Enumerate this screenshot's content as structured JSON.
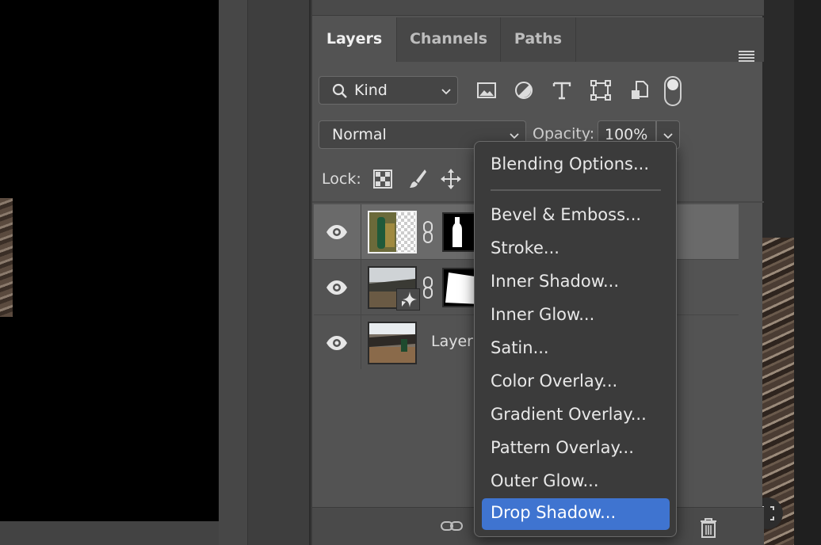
{
  "panel": {
    "tabs": [
      {
        "label": "Layers",
        "active": true
      },
      {
        "label": "Channels",
        "active": false
      },
      {
        "label": "Paths",
        "active": false
      }
    ],
    "filter": {
      "kind_label": "Kind",
      "icons": [
        "image-filter-icon",
        "adjustment-filter-icon",
        "type-filter-icon",
        "shape-filter-icon",
        "smart-object-filter-icon"
      ]
    },
    "blend_mode": "Normal",
    "opacity_label": "Opacity:",
    "opacity_value": "100%",
    "lock_label": "Lock:",
    "layers": [
      {
        "name": "",
        "visible": true,
        "selected": true,
        "has_mask": true
      },
      {
        "name": "",
        "visible": true,
        "selected": false,
        "has_mask": true,
        "smart_object": true
      },
      {
        "name": "Layer",
        "visible": true,
        "selected": false,
        "has_mask": false
      }
    ]
  },
  "context_menu": {
    "items": [
      {
        "label": "Blending Options...",
        "highlighted": false
      },
      {
        "label": "Bevel & Emboss...",
        "highlighted": false
      },
      {
        "label": "Stroke...",
        "highlighted": false
      },
      {
        "label": "Inner Shadow...",
        "highlighted": false
      },
      {
        "label": "Inner Glow...",
        "highlighted": false
      },
      {
        "label": "Satin...",
        "highlighted": false
      },
      {
        "label": "Color Overlay...",
        "highlighted": false
      },
      {
        "label": "Gradient Overlay...",
        "highlighted": false
      },
      {
        "label": "Pattern Overlay...",
        "highlighted": false
      },
      {
        "label": "Outer Glow...",
        "highlighted": false
      },
      {
        "label": "Drop Shadow...",
        "highlighted": true
      }
    ]
  },
  "colors": {
    "panel_bg": "#535353",
    "menu_bg": "#3b3b3b",
    "highlight": "#3f74d0",
    "selected_row": "#6a6a6a"
  }
}
